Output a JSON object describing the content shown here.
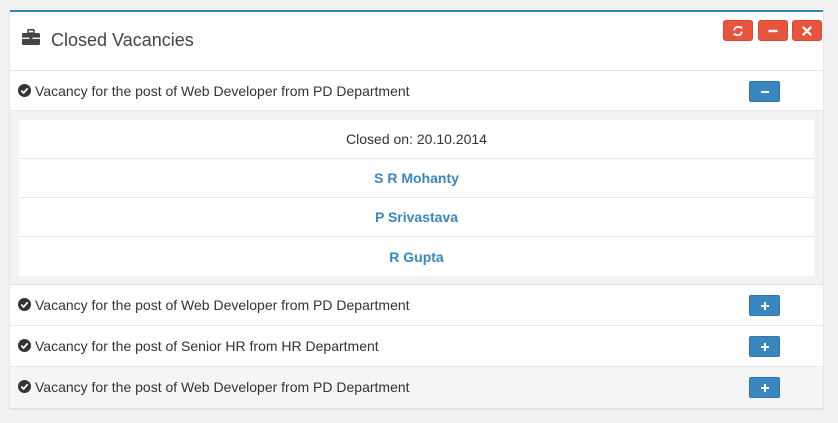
{
  "panel": {
    "title": "Closed Vacancies",
    "icon": "briefcase-icon",
    "tools": [
      "refresh-icon",
      "minus-icon",
      "close-icon"
    ],
    "accent_color": "#2e86b3",
    "tool_color": "#e7553e"
  },
  "vacancies": [
    {
      "label": "Vacancy for the post of Web Developer from PD Department",
      "expanded": true,
      "closed_on": "Closed on: 20.10.2014",
      "candidates": [
        "S R Mohanty",
        "P Srivastava",
        "R Gupta"
      ]
    },
    {
      "label": "Vacancy for the post of Web Developer from PD Department",
      "expanded": false
    },
    {
      "label": "Vacancy for the post of Senior HR from HR Department",
      "expanded": false
    },
    {
      "label": "Vacancy for the post of Web Developer from PD Department",
      "expanded": false
    }
  ],
  "colors": {
    "button_blue": "#3a87c0",
    "link_blue": "#3a87c0"
  }
}
